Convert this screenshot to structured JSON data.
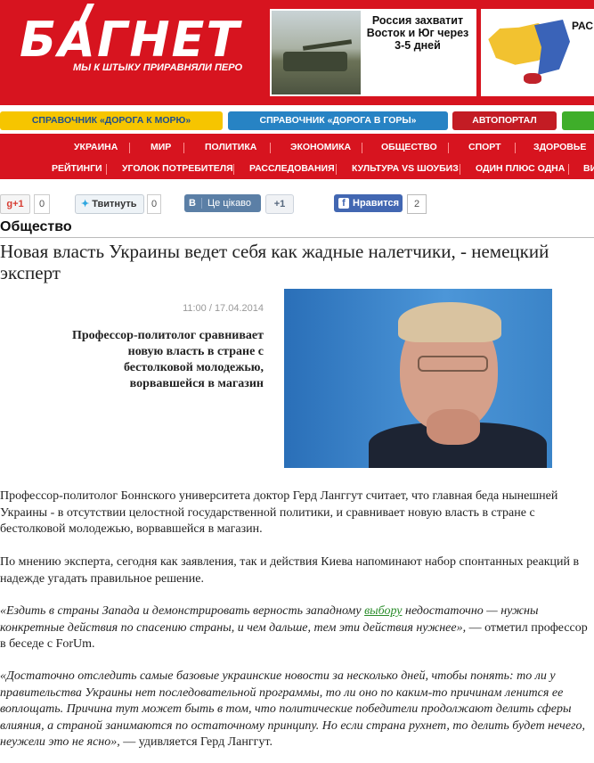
{
  "site": {
    "logo": "БАГНЕТ",
    "slogan": "МЫ К ШТЫКУ ПРИРАВНЯЛИ ПЕРО"
  },
  "ads": {
    "ad1_text": "Россия захватит Восток и Юг через 3-5 дней",
    "ad2_text": "РАС"
  },
  "guides": [
    "СПРАВОЧНИК «ДОРОГА К МОРЮ»",
    "СПРАВОЧНИК «ДОРОГА В ГОРЫ»",
    "АВТОПОРТАЛ",
    ""
  ],
  "nav": {
    "row1": [
      "УКРАИНА",
      "МИР",
      "ПОЛИТИКА",
      "ЭКОНОМИКА",
      "ОБЩЕСТВО",
      "СПОРТ",
      "ЗДОРОВЬЕ"
    ],
    "row2": [
      "РЕЙТИНГИ",
      "УГОЛОК ПОТРЕБИТЕЛЯ",
      "РАССЛЕДОВАНИЯ",
      "КУЛЬТУРА VS ШОУБИЗ",
      "ОДИН ПЛЮС ОДНА",
      "ВИ"
    ]
  },
  "social": {
    "gplus_label": "g+1",
    "gplus_count": "0",
    "twitter_label": "Твитнуть",
    "twitter_count": "0",
    "vk_label": "Це цікаво",
    "vk_count": "+1",
    "fb_label": "Нравится",
    "fb_count": "2",
    "brand_color_vk": "#5b7fa6",
    "brand_color_fb": "#4267b2"
  },
  "article": {
    "section": "Общество",
    "title": "Новая власть Украины ведет себя как жадные налетчики, - немецкий эксперт",
    "dateline": "11:00 / 17.04.2014",
    "lead": "Профессор-политолог сравнивает новую власть в стране с бестолковой молодежью, ворвавшейся в магазин",
    "p1": "Профессор-политолог Боннского университета доктор Герд Ланггут считает, что главная беда нынешней Украины - в отсутствии целостной государственной политики, и сравнивает новую власть в стране с бестолковой молодежью, ворвавшейся в магазин.",
    "p2": "По мнению эксперта, сегодня как заявления, так и действия Киева напоминают набор спонтанных реакций в надежде угадать правильное решение.",
    "p3_before": "«Ездить в страны Запада и демонстрировать верность западному ",
    "p3_link": "выбору",
    "p3_after": " недостаточно — нужны конкретные действия по спасению страны, и чем дальше, тем эти действия нужнее»,",
    "p3_tail": " — отметил профессор в беседе с ForUm.",
    "p4": "«Достаточно отследить самые базовые украинские новости за несколько дней, чтобы понять: то ли у правительства Украины нет последовательной программы, то ли оно по каким-то причинам ленится ее воплощать. Причина тут может быть в том, что политические победители продолжают делить сферы влияния, а страной занимаются по остаточному принципу. Но если страна рухнет, то делить будет нечего, неужели это не ясно»,",
    "p4_tail": " — удивляется Герд Ланггут."
  }
}
